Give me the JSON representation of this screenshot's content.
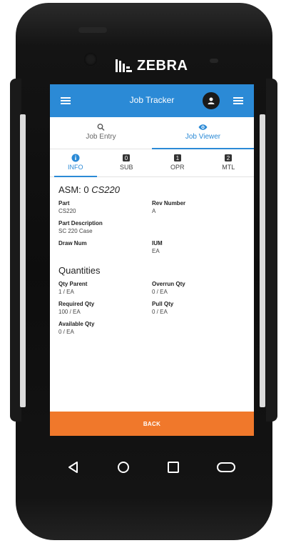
{
  "device": {
    "brand": "ZEBRA"
  },
  "appbar": {
    "title": "Job Tracker",
    "left_icon": "hamburger-menu-icon",
    "avatar_icon": "user-avatar-icon",
    "right_icon": "hamburger-menu-icon"
  },
  "main_tabs": [
    {
      "label": "Job Entry",
      "icon": "search-icon",
      "active": false
    },
    {
      "label": "Job Viewer",
      "icon": "eye-icon",
      "active": true
    }
  ],
  "sub_tabs": [
    {
      "label": "INFO",
      "icon": "info-icon",
      "active": true
    },
    {
      "label": "SUB",
      "icon": "badge-icon",
      "badge": "0",
      "active": false
    },
    {
      "label": "OPR",
      "icon": "badge-icon",
      "badge": "1",
      "active": false
    },
    {
      "label": "MTL",
      "icon": "badge-icon",
      "badge": "2",
      "active": false
    }
  ],
  "asm": {
    "prefix": "ASM: 0",
    "name": "CS220"
  },
  "fields": {
    "part_label": "Part",
    "part_value": "CS220",
    "rev_label": "Rev Number",
    "rev_value": "A",
    "desc_label": "Part Description",
    "desc_value": "SC 220 Case",
    "draw_label": "Draw Num",
    "draw_value": "",
    "ium_label": "IUM",
    "ium_value": "EA"
  },
  "quantities": {
    "title": "Quantities",
    "qty_parent_label": "Qty Parent",
    "qty_parent_value": "1 / EA",
    "overrun_label": "Overrun Qty",
    "overrun_value": "0 / EA",
    "required_label": "Required Qty",
    "required_value": "100 / EA",
    "pull_label": "Pull Qty",
    "pull_value": "0 / EA",
    "available_label": "Available Qty",
    "available_value": "0 / EA"
  },
  "back_button": {
    "label": "BACK"
  },
  "nav_bar": [
    "back-triangle-icon",
    "home-circle-icon",
    "recents-square-icon",
    "assistant-pill-icon"
  ],
  "colors": {
    "primary": "#2b8ad6",
    "accent_button": "#f0782b"
  }
}
